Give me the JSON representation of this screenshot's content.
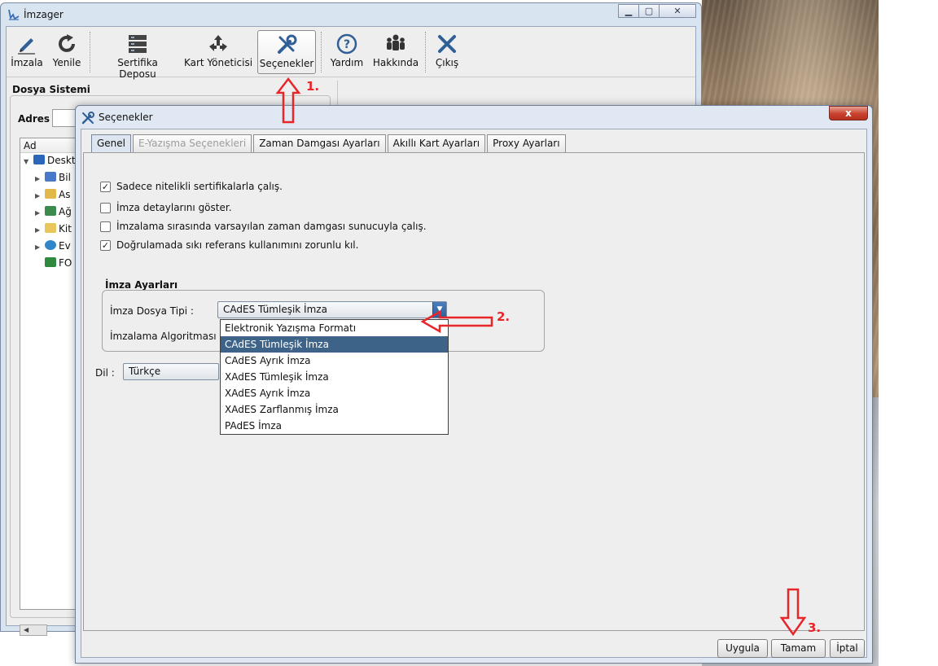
{
  "main_window": {
    "title": "İmzager",
    "toolbar": [
      {
        "label": "İmzala",
        "icon": "pen-icon"
      },
      {
        "label": "Yenile",
        "icon": "refresh-icon"
      },
      {
        "label": "Sertifika Deposu",
        "icon": "server-icon"
      },
      {
        "label": "Kart Yöneticisi",
        "icon": "card-manager-icon"
      },
      {
        "label": "Seçenekler",
        "icon": "tools-icon"
      },
      {
        "label": "Yardım",
        "icon": "help-icon"
      },
      {
        "label": "Hakkında",
        "icon": "people-icon"
      },
      {
        "label": "Çıkış",
        "icon": "exit-icon"
      }
    ],
    "file_system": {
      "header": "Dosya Sistemi",
      "address_label": "Adres :",
      "column_header": "Ad",
      "tree": [
        {
          "label": "Deskt",
          "icon": "desktop-icon"
        },
        {
          "label": "Bil",
          "icon": "computer-icon"
        },
        {
          "label": "As",
          "icon": "user-folder-icon"
        },
        {
          "label": "Ağ",
          "icon": "network-icon"
        },
        {
          "label": "Kit",
          "icon": "library-icon"
        },
        {
          "label": "Ev",
          "icon": "homegroup-icon"
        },
        {
          "label": "FO",
          "icon": "excel-file-icon"
        }
      ]
    }
  },
  "dialog": {
    "title": "Seçenekler",
    "tabs": [
      {
        "label": "Genel",
        "state": "selected"
      },
      {
        "label": "E-Yazışma Seçenekleri",
        "state": "disabled"
      },
      {
        "label": "Zaman Damgası Ayarları",
        "state": "normal"
      },
      {
        "label": "Akıllı Kart Ayarları",
        "state": "normal"
      },
      {
        "label": "Proxy Ayarları",
        "state": "normal"
      }
    ],
    "checkboxes": [
      {
        "label": "Sadece nitelikli sertifikalarla çalış.",
        "checked": true
      },
      {
        "label": "İmza detaylarını göster.",
        "checked": false
      },
      {
        "label": "İmzalama sırasında varsayılan zaman damgası sunucuyla çalış.",
        "checked": false
      },
      {
        "label": "Doğrulamada sıkı referans kullanımını zorunlu kıl.",
        "checked": true
      }
    ],
    "signature_settings": {
      "group_title": "İmza Ayarları",
      "file_type_label": "İmza Dosya Tipi :",
      "file_type_value": "CAdES Tümleşik İmza",
      "algorithm_label": "İmzalama Algoritması :",
      "file_type_options": [
        "Elektronik Yazışma Formatı",
        "CAdES Tümleşik İmza",
        "CAdES Ayrık İmza",
        "XAdES Tümleşik İmza",
        "XAdES Ayrık İmza",
        "XAdES Zarflanmış İmza",
        "PAdES İmza"
      ],
      "selected_option": "CAdES Tümleşik İmza"
    },
    "language": {
      "label": "Dil :",
      "value": "Türkçe"
    },
    "buttons": {
      "apply": "Uygula",
      "ok": "Tamam",
      "cancel": "İptal"
    },
    "close_symbol": "x"
  },
  "annotations": {
    "step1": "1.",
    "step2": "2.",
    "step3": "3.",
    "color": "#e8262a"
  },
  "colors": {
    "selection": "#3e6389",
    "window_frame": "#dfe8f3"
  }
}
